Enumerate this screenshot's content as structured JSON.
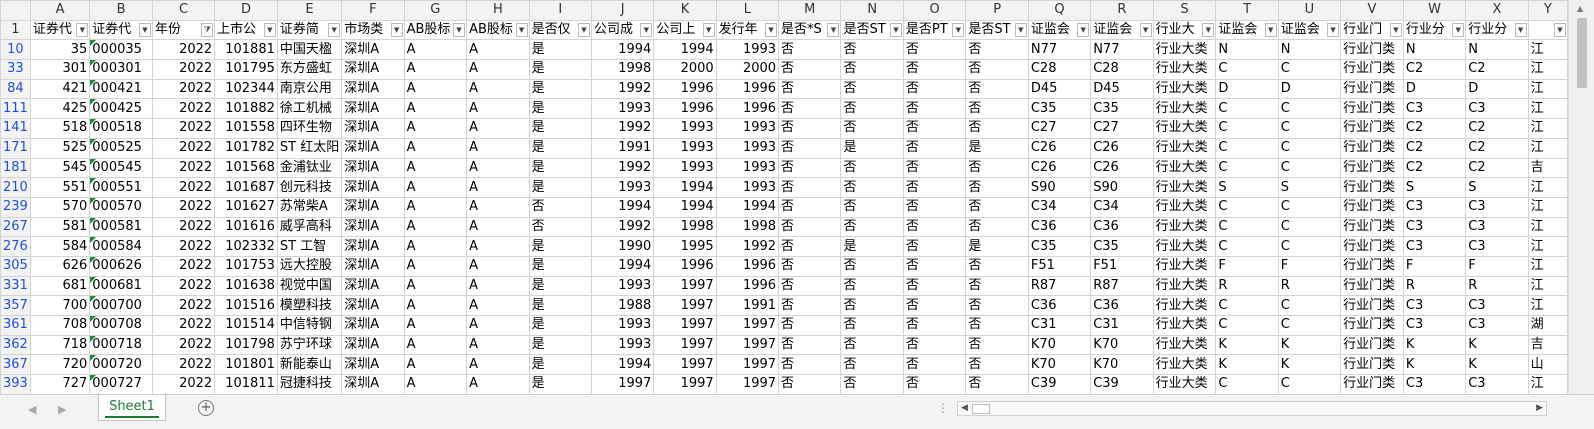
{
  "sheet": {
    "columns": [
      "A",
      "B",
      "C",
      "D",
      "E",
      "F",
      "G",
      "H",
      "I",
      "J",
      "K",
      "L",
      "M",
      "N",
      "O",
      "P",
      "Q",
      "R",
      "S",
      "T",
      "U",
      "V",
      "W",
      "X",
      "Y"
    ],
    "header_row_number": "1",
    "headers": [
      "证券代",
      "证券代",
      "年份",
      "上市公",
      "证券简",
      "市场类",
      "AB股标",
      "AB股标",
      "是否仅",
      "公司成",
      "公司上",
      "发行年",
      "是否*S",
      "是否ST",
      "是否PT",
      "是否ST",
      "证监会",
      "证监会",
      "行业大",
      "证监会",
      "证监会",
      "行业门",
      "行业分",
      "行业分",
      ""
    ],
    "filtered_columns": [
      "C"
    ],
    "rows": [
      {
        "row": "10",
        "cells": [
          "35",
          "000035",
          "2022",
          "101881",
          "中国天楹",
          "深圳A",
          "A",
          "A",
          "是",
          "1994",
          "1994",
          "1993",
          "否",
          "否",
          "否",
          "否",
          "N77",
          "N77",
          "行业大类",
          "N",
          "N",
          "行业门类",
          "N",
          "N",
          "江"
        ]
      },
      {
        "row": "33",
        "cells": [
          "301",
          "000301",
          "2022",
          "101795",
          "东方盛虹",
          "深圳A",
          "A",
          "A",
          "是",
          "1998",
          "2000",
          "2000",
          "否",
          "否",
          "否",
          "否",
          "C28",
          "C28",
          "行业大类",
          "C",
          "C",
          "行业门类",
          "C2",
          "C2",
          "江"
        ]
      },
      {
        "row": "84",
        "cells": [
          "421",
          "000421",
          "2022",
          "102344",
          "南京公用",
          "深圳A",
          "A",
          "A",
          "是",
          "1992",
          "1996",
          "1996",
          "否",
          "否",
          "否",
          "否",
          "D45",
          "D45",
          "行业大类",
          "D",
          "D",
          "行业门类",
          "D",
          "D",
          "江"
        ]
      },
      {
        "row": "111",
        "cells": [
          "425",
          "000425",
          "2022",
          "101882",
          "徐工机械",
          "深圳A",
          "A",
          "A",
          "是",
          "1993",
          "1996",
          "1996",
          "否",
          "否",
          "否",
          "否",
          "C35",
          "C35",
          "行业大类",
          "C",
          "C",
          "行业门类",
          "C3",
          "C3",
          "江"
        ]
      },
      {
        "row": "141",
        "cells": [
          "518",
          "000518",
          "2022",
          "101558",
          "四环生物",
          "深圳A",
          "A",
          "A",
          "是",
          "1992",
          "1993",
          "1993",
          "否",
          "否",
          "否",
          "否",
          "C27",
          "C27",
          "行业大类",
          "C",
          "C",
          "行业门类",
          "C2",
          "C2",
          "江"
        ]
      },
      {
        "row": "171",
        "cells": [
          "525",
          "000525",
          "2022",
          "101782",
          "ST 红太阳",
          "深圳A",
          "A",
          "A",
          "是",
          "1991",
          "1993",
          "1993",
          "否",
          "是",
          "否",
          "是",
          "C26",
          "C26",
          "行业大类",
          "C",
          "C",
          "行业门类",
          "C2",
          "C2",
          "江"
        ]
      },
      {
        "row": "181",
        "cells": [
          "545",
          "000545",
          "2022",
          "101568",
          "金浦钛业",
          "深圳A",
          "A",
          "A",
          "是",
          "1992",
          "1993",
          "1993",
          "否",
          "否",
          "否",
          "否",
          "C26",
          "C26",
          "行业大类",
          "C",
          "C",
          "行业门类",
          "C2",
          "C2",
          "吉"
        ]
      },
      {
        "row": "210",
        "cells": [
          "551",
          "000551",
          "2022",
          "101687",
          "创元科技",
          "深圳A",
          "A",
          "A",
          "是",
          "1993",
          "1994",
          "1993",
          "否",
          "否",
          "否",
          "否",
          "S90",
          "S90",
          "行业大类",
          "S",
          "S",
          "行业门类",
          "S",
          "S",
          "江"
        ]
      },
      {
        "row": "239",
        "cells": [
          "570",
          "000570",
          "2022",
          "101627",
          "苏常柴A",
          "深圳A",
          "A",
          "A",
          "否",
          "1994",
          "1994",
          "1994",
          "否",
          "否",
          "否",
          "否",
          "C34",
          "C34",
          "行业大类",
          "C",
          "C",
          "行业门类",
          "C3",
          "C3",
          "江"
        ]
      },
      {
        "row": "267",
        "cells": [
          "581",
          "000581",
          "2022",
          "101616",
          "威孚高科",
          "深圳A",
          "A",
          "A",
          "否",
          "1992",
          "1998",
          "1998",
          "否",
          "否",
          "否",
          "否",
          "C36",
          "C36",
          "行业大类",
          "C",
          "C",
          "行业门类",
          "C3",
          "C3",
          "江"
        ]
      },
      {
        "row": "276",
        "cells": [
          "584",
          "000584",
          "2022",
          "102332",
          "ST 工智",
          "深圳A",
          "A",
          "A",
          "是",
          "1990",
          "1995",
          "1992",
          "否",
          "是",
          "否",
          "是",
          "C35",
          "C35",
          "行业大类",
          "C",
          "C",
          "行业门类",
          "C3",
          "C3",
          "江"
        ]
      },
      {
        "row": "305",
        "cells": [
          "626",
          "000626",
          "2022",
          "101753",
          "远大控股",
          "深圳A",
          "A",
          "A",
          "是",
          "1994",
          "1996",
          "1996",
          "否",
          "否",
          "否",
          "否",
          "F51",
          "F51",
          "行业大类",
          "F",
          "F",
          "行业门类",
          "F",
          "F",
          "江"
        ]
      },
      {
        "row": "331",
        "cells": [
          "681",
          "000681",
          "2022",
          "101638",
          "视觉中国",
          "深圳A",
          "A",
          "A",
          "是",
          "1993",
          "1997",
          "1996",
          "否",
          "否",
          "否",
          "否",
          "R87",
          "R87",
          "行业大类",
          "R",
          "R",
          "行业门类",
          "R",
          "R",
          "江"
        ]
      },
      {
        "row": "357",
        "cells": [
          "700",
          "000700",
          "2022",
          "101516",
          "模塑科技",
          "深圳A",
          "A",
          "A",
          "是",
          "1988",
          "1997",
          "1991",
          "否",
          "否",
          "否",
          "否",
          "C36",
          "C36",
          "行业大类",
          "C",
          "C",
          "行业门类",
          "C3",
          "C3",
          "江"
        ]
      },
      {
        "row": "361",
        "cells": [
          "708",
          "000708",
          "2022",
          "101514",
          "中信特钢",
          "深圳A",
          "A",
          "A",
          "是",
          "1993",
          "1997",
          "1997",
          "否",
          "否",
          "否",
          "否",
          "C31",
          "C31",
          "行业大类",
          "C",
          "C",
          "行业门类",
          "C3",
          "C3",
          "湖"
        ]
      },
      {
        "row": "362",
        "cells": [
          "718",
          "000718",
          "2022",
          "101798",
          "苏宁环球",
          "深圳A",
          "A",
          "A",
          "是",
          "1993",
          "1997",
          "1997",
          "否",
          "否",
          "否",
          "否",
          "K70",
          "K70",
          "行业大类",
          "K",
          "K",
          "行业门类",
          "K",
          "K",
          "吉"
        ]
      },
      {
        "row": "367",
        "cells": [
          "720",
          "000720",
          "2022",
          "101801",
          "新能泰山",
          "深圳A",
          "A",
          "A",
          "是",
          "1994",
          "1997",
          "1997",
          "否",
          "否",
          "否",
          "否",
          "K70",
          "K70",
          "行业大类",
          "K",
          "K",
          "行业门类",
          "K",
          "K",
          "山"
        ]
      },
      {
        "row": "393",
        "cells": [
          "727",
          "000727",
          "2022",
          "101811",
          "冠捷科技",
          "深圳A",
          "A",
          "A",
          "是",
          "1997",
          "1997",
          "1997",
          "否",
          "否",
          "否",
          "否",
          "C39",
          "C39",
          "行业大类",
          "C",
          "C",
          "行业门类",
          "C3",
          "C3",
          "江"
        ]
      }
    ],
    "numeric_columns": [
      "A",
      "C",
      "D",
      "J",
      "K",
      "L"
    ],
    "code_column": "B"
  },
  "tabs": {
    "sheet_name": "Sheet1",
    "add_icon": "plus-circle-icon"
  },
  "colors": {
    "row_number_blue": "#1f4fd6",
    "tab_green": "#1f7a3a"
  }
}
